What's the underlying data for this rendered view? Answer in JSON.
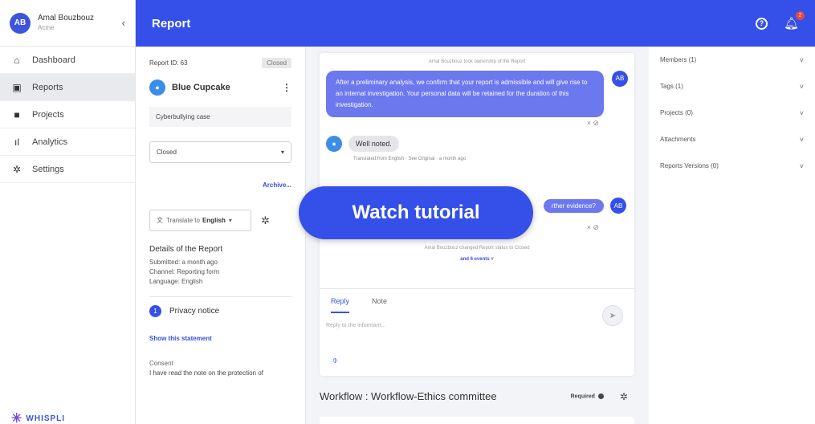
{
  "user": {
    "initials": "AB",
    "name": "Amal Bouzbouz",
    "org": "Acme",
    "collapse": "‹"
  },
  "nav": [
    {
      "icon": "home-icon",
      "glyph": "⌂",
      "label": "Dashboard"
    },
    {
      "icon": "reports-icon",
      "glyph": "▣",
      "label": "Reports"
    },
    {
      "icon": "folder-icon",
      "glyph": "■",
      "label": "Projects"
    },
    {
      "icon": "analytics-icon",
      "glyph": "ıl",
      "label": "Analytics"
    },
    {
      "icon": "settings-icon",
      "glyph": "✲",
      "label": "Settings"
    }
  ],
  "logo": {
    "text": "WHISPLI"
  },
  "header": {
    "title": "Report",
    "help": "?",
    "notifications": "2"
  },
  "report": {
    "id_label": "Report ID: 63",
    "status_tag": "Closed",
    "reporter": "Blue Cupcake",
    "case": "Cyberbullying case",
    "status_value": "Closed",
    "archive": "Archive...",
    "translate_prefix": "Translate to",
    "translate_lang": "English",
    "details_title": "Details of the Report",
    "submitted": "Submitted: a month ago",
    "channel": "Channel: Reporting form",
    "language": "Language: English",
    "privacy_num": "1",
    "privacy": "Privacy notice",
    "show_statement": "Show this statement",
    "consent_label": "Consent",
    "consent_text": "I have read the note on the protection of"
  },
  "chat": {
    "sys1": "Amal Bouzbouz took ownership of the Report",
    "msg1": "After a preliminary analysis, we confirm that your report is admissible and will give rise to an internal investigation. Your personal data will be retained for the duration of this investigation.",
    "msg1_avatar": "AB",
    "msg1_actions": "× ⊘",
    "msg2": "Well noted.",
    "translated": "Translated from English · See Original · a month ago",
    "msg3": "rther evidence?",
    "msg3_avatar": "AB",
    "msg3_actions": "× ⊘",
    "sys2": "Amal Bouzbouz changed Report status to Closed",
    "events": "and 6 events ˅",
    "tab_reply": "Reply",
    "tab_note": "Note",
    "reply_placeholder": "Reply to the informant..."
  },
  "tutorial": {
    "label": "Watch tutorial"
  },
  "workflow": {
    "title": "Workflow : Workflow-Ethics committee",
    "required": "Required"
  },
  "right_panel": [
    {
      "label": "Members (1)"
    },
    {
      "label": "Tags (1)"
    },
    {
      "label": "Projects (0)"
    },
    {
      "label": "Attachments"
    },
    {
      "label": "Reports Versions (0)"
    }
  ],
  "colors": {
    "accent": "#3550e8",
    "bubble": "#6c78ee",
    "danger": "#e84545"
  }
}
